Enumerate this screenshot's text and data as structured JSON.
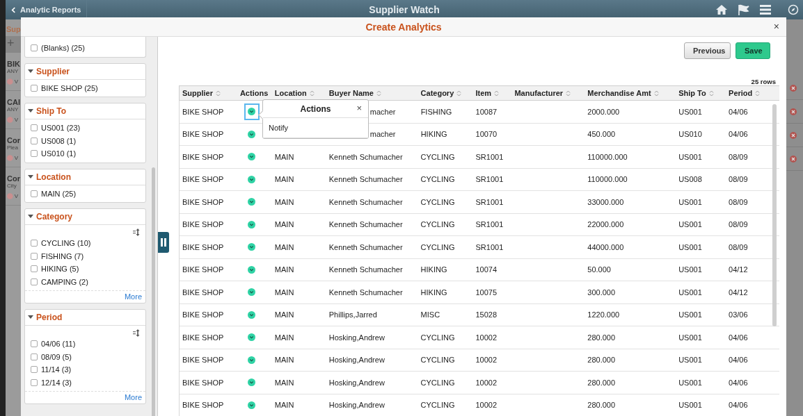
{
  "top_bar": {
    "back_label": "Analytic Reports",
    "title": "Supplier Watch"
  },
  "background_page": {
    "left_texts": [
      {
        "text": "Sup",
        "kind": "heading"
      },
      {
        "text": "+",
        "kind": "add"
      },
      {
        "text": "BIK",
        "kind": "title"
      },
      {
        "text": "ANY",
        "kind": "sub"
      },
      {
        "text": "V",
        "kind": "alert"
      },
      {
        "text": "CAI",
        "kind": "title"
      },
      {
        "text": "ANY",
        "kind": "sub"
      },
      {
        "text": "V",
        "kind": "alert"
      },
      {
        "text": "Cor",
        "kind": "title"
      },
      {
        "text": "Plea",
        "kind": "sub"
      },
      {
        "text": "V",
        "kind": "alert"
      },
      {
        "text": "Cor",
        "kind": "title"
      },
      {
        "text": "City",
        "kind": "sub"
      },
      {
        "text": "V",
        "kind": "alert"
      }
    ]
  },
  "dialog": {
    "title": "Create Analytics",
    "close": "×"
  },
  "filters": [
    {
      "items": [
        {
          "label": "(Blanks) (25)",
          "checked": false
        }
      ]
    },
    {
      "title": "Supplier",
      "items": [
        {
          "label": "BIKE SHOP (25)",
          "checked": false
        }
      ]
    },
    {
      "title": "Ship To",
      "items": [
        {
          "label": "US001 (23)",
          "checked": false
        },
        {
          "label": "US008 (1)",
          "checked": false
        },
        {
          "label": "US010 (1)",
          "checked": false
        }
      ]
    },
    {
      "title": "Location",
      "items": [
        {
          "label": "MAIN (25)",
          "checked": false
        }
      ]
    },
    {
      "title": "Category",
      "sortable": true,
      "more": "More",
      "items": [
        {
          "label": "CYCLING (10)",
          "checked": false
        },
        {
          "label": "FISHING (7)",
          "checked": false
        },
        {
          "label": "HIKING (5)",
          "checked": false
        },
        {
          "label": "CAMPING (2)",
          "checked": false
        }
      ]
    },
    {
      "title": "Period",
      "sortable": true,
      "more": "More",
      "items": [
        {
          "label": "04/06 (11)",
          "checked": false
        },
        {
          "label": "08/09 (5)",
          "checked": false
        },
        {
          "label": "11/14 (3)",
          "checked": false
        },
        {
          "label": "12/14 (3)",
          "checked": false
        }
      ]
    }
  ],
  "buttons": [
    {
      "label": "Previous",
      "kind": "secondary"
    },
    {
      "label": "Save",
      "kind": "primary"
    }
  ],
  "row_count": "25 rows",
  "table": {
    "columns": [
      {
        "label": "Supplier",
        "sortable": true
      },
      {
        "label": "Actions",
        "sortable": false
      },
      {
        "label": "Location",
        "sortable": true
      },
      {
        "label": "Buyer Name",
        "sortable": true
      },
      {
        "label": "Category",
        "sortable": true
      },
      {
        "label": "Item",
        "sortable": true
      },
      {
        "label": "Manufacturer",
        "sortable": true
      },
      {
        "label": "Merchandise Amt",
        "sortable": true
      },
      {
        "label": "Ship To",
        "sortable": true
      },
      {
        "label": "Period",
        "sortable": true
      }
    ],
    "rows": [
      {
        "supplier": "BIKE SHOP",
        "selected": true,
        "under_popup": true,
        "buyer": "macher",
        "category": "FISHING",
        "item": "10087",
        "amount": "2000.000",
        "ship_to": "US001",
        "period": "04/06"
      },
      {
        "supplier": "BIKE SHOP",
        "selected": false,
        "under_popup": true,
        "buyer": "macher",
        "category": "HIKING",
        "item": "10070",
        "amount": "450.000",
        "ship_to": "US010",
        "period": "04/06"
      },
      {
        "supplier": "BIKE SHOP",
        "selected": false,
        "location": "MAIN",
        "buyer": "Kenneth Schumacher",
        "category": "CYCLING",
        "item": "SR1001",
        "amount": "110000.000",
        "ship_to": "US001",
        "period": "08/09"
      },
      {
        "supplier": "BIKE SHOP",
        "selected": false,
        "location": "MAIN",
        "buyer": "Kenneth Schumacher",
        "category": "CYCLING",
        "item": "SR1001",
        "amount": "110000.000",
        "ship_to": "US008",
        "period": "08/09"
      },
      {
        "supplier": "BIKE SHOP",
        "selected": false,
        "location": "MAIN",
        "buyer": "Kenneth Schumacher",
        "category": "CYCLING",
        "item": "SR1001",
        "amount": "33000.000",
        "ship_to": "US001",
        "period": "08/09"
      },
      {
        "supplier": "BIKE SHOP",
        "selected": false,
        "location": "MAIN",
        "buyer": "Kenneth Schumacher",
        "category": "CYCLING",
        "item": "SR1001",
        "amount": "22000.000",
        "ship_to": "US001",
        "period": "08/09"
      },
      {
        "supplier": "BIKE SHOP",
        "selected": false,
        "location": "MAIN",
        "buyer": "Kenneth Schumacher",
        "category": "CYCLING",
        "item": "SR1001",
        "amount": "44000.000",
        "ship_to": "US001",
        "period": "08/09"
      },
      {
        "supplier": "BIKE SHOP",
        "selected": false,
        "location": "MAIN",
        "buyer": "Kenneth Schumacher",
        "category": "HIKING",
        "item": "10074",
        "amount": "50.000",
        "ship_to": "US001",
        "period": "04/12"
      },
      {
        "supplier": "BIKE SHOP",
        "selected": false,
        "location": "MAIN",
        "buyer": "Kenneth Schumacher",
        "category": "HIKING",
        "item": "10075",
        "amount": "300.000",
        "ship_to": "US001",
        "period": "04/12"
      },
      {
        "supplier": "BIKE SHOP",
        "selected": false,
        "location": "MAIN",
        "buyer": "Phillips,Jarred",
        "category": "MISC",
        "item": "15028",
        "amount": "1220.000",
        "ship_to": "US001",
        "period": "03/06"
      },
      {
        "supplier": "BIKE SHOP",
        "selected": false,
        "location": "MAIN",
        "buyer": "Hosking,Andrew",
        "category": "CYCLING",
        "item": "10002",
        "amount": "280.000",
        "ship_to": "US001",
        "period": "04/06"
      },
      {
        "supplier": "BIKE SHOP",
        "selected": false,
        "location": "MAIN",
        "buyer": "Hosking,Andrew",
        "category": "CYCLING",
        "item": "10002",
        "amount": "280.000",
        "ship_to": "US001",
        "period": "04/06"
      },
      {
        "supplier": "BIKE SHOP",
        "selected": false,
        "location": "MAIN",
        "buyer": "Hosking,Andrew",
        "category": "CYCLING",
        "item": "10002",
        "amount": "280.000",
        "ship_to": "US001",
        "period": "04/06"
      },
      {
        "supplier": "BIKE SHOP",
        "selected": false,
        "location": "MAIN",
        "buyer": "Hosking,Andrew",
        "category": "CYCLING",
        "item": "10002",
        "amount": "280.000",
        "ship_to": "US001",
        "period": "04/06"
      }
    ]
  },
  "popup": {
    "title": "Actions",
    "close": "×",
    "items": [
      "Notify"
    ]
  }
}
